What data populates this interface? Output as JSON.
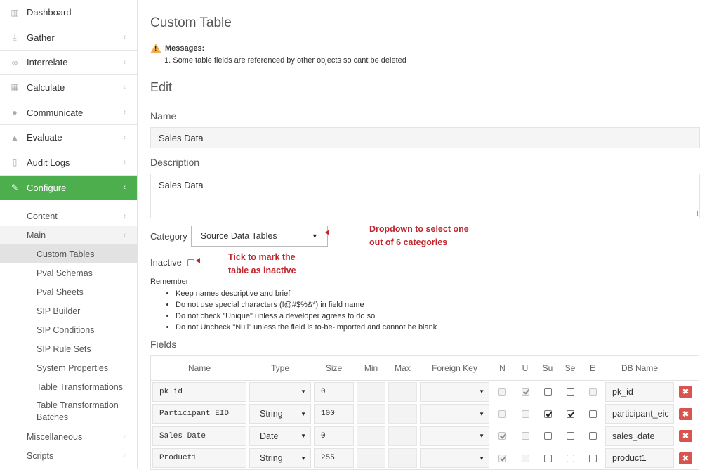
{
  "sidebar": {
    "items": [
      {
        "label": "Dashboard",
        "icon": "bar-chart-icon"
      },
      {
        "label": "Gather",
        "icon": "download-icon"
      },
      {
        "label": "Interrelate",
        "icon": "link-icon"
      },
      {
        "label": "Calculate",
        "icon": "table-icon"
      },
      {
        "label": "Communicate",
        "icon": "comments-icon"
      },
      {
        "label": "Evaluate",
        "icon": "thumbs-up-icon"
      },
      {
        "label": "Audit Logs",
        "icon": "file-icon"
      },
      {
        "label": "Configure",
        "icon": "wrench-icon"
      }
    ],
    "sub": {
      "content": "Content",
      "main": "Main",
      "main_items": [
        "Custom Tables",
        "Pval Schemas",
        "Pval Sheets",
        "SIP Builder",
        "SIP Conditions",
        "SIP Rule Sets",
        "System Properties",
        "Table Transformations",
        "Table Transformation Batches"
      ],
      "misc": "Miscellaneous",
      "scripts": "Scripts"
    }
  },
  "page": {
    "title": "Custom Table",
    "messages_title": "Messages:",
    "message_1": "1.  Some table fields are referenced by other objects so cant be deleted",
    "edit_heading": "Edit",
    "name_label": "Name",
    "name_value": "Sales Data",
    "description_label": "Description",
    "description_value": "Sales Data",
    "category_label": "Category",
    "category_value": "Source Data Tables",
    "inactive_label": "Inactive",
    "remember_title": "Remember",
    "remember_items": [
      "Keep names descriptive and brief",
      "Do not use special characters (!@#$%&*) in field name",
      "Do not check \"Unique\" unless a developer agrees to do so",
      "Do not Uncheck \"Null\" unless the field is to-be-imported and cannot be blank"
    ],
    "fields_label": "Fields"
  },
  "annotations": {
    "dropdown_line1": "Dropdown to select one",
    "dropdown_line2": "out of 6 categories",
    "inactive_line1": "Tick to mark the",
    "inactive_line2": "table as inactive"
  },
  "fields_table": {
    "headers": [
      "Name",
      "Type",
      "Size",
      "Min",
      "Max",
      "Foreign Key",
      "N",
      "U",
      "Su",
      "Se",
      "E",
      "DB Name"
    ],
    "rows": [
      {
        "name": "pk id",
        "type": "",
        "size": "0",
        "db": "pk_id",
        "N": {
          "on": false,
          "dis": true
        },
        "U": {
          "on": true,
          "dis": true
        },
        "Su": {
          "on": false,
          "dis": false
        },
        "Se": {
          "on": false,
          "dis": false
        },
        "E": {
          "on": false,
          "dis": true
        }
      },
      {
        "name": "Participant EID",
        "type": "String",
        "size": "100",
        "db": "participant_eic",
        "N": {
          "on": false,
          "dis": true
        },
        "U": {
          "on": false,
          "dis": true
        },
        "Su": {
          "on": true,
          "dis": false
        },
        "Se": {
          "on": true,
          "dis": false
        },
        "E": {
          "on": false,
          "dis": false
        }
      },
      {
        "name": "Sales Date",
        "type": "Date",
        "size": "0",
        "db": "sales_date",
        "N": {
          "on": true,
          "dis": true
        },
        "U": {
          "on": false,
          "dis": true
        },
        "Su": {
          "on": false,
          "dis": false
        },
        "Se": {
          "on": false,
          "dis": false
        },
        "E": {
          "on": false,
          "dis": false
        }
      },
      {
        "name": "Product1",
        "type": "String",
        "size": "255",
        "db": "product1",
        "N": {
          "on": true,
          "dis": true
        },
        "U": {
          "on": false,
          "dis": true
        },
        "Su": {
          "on": false,
          "dis": false
        },
        "Se": {
          "on": false,
          "dis": false
        },
        "E": {
          "on": false,
          "dis": false
        }
      }
    ]
  },
  "colors": {
    "accent": "#4cae4c",
    "annotation": "#c0262d",
    "delete": "#d9534f"
  }
}
